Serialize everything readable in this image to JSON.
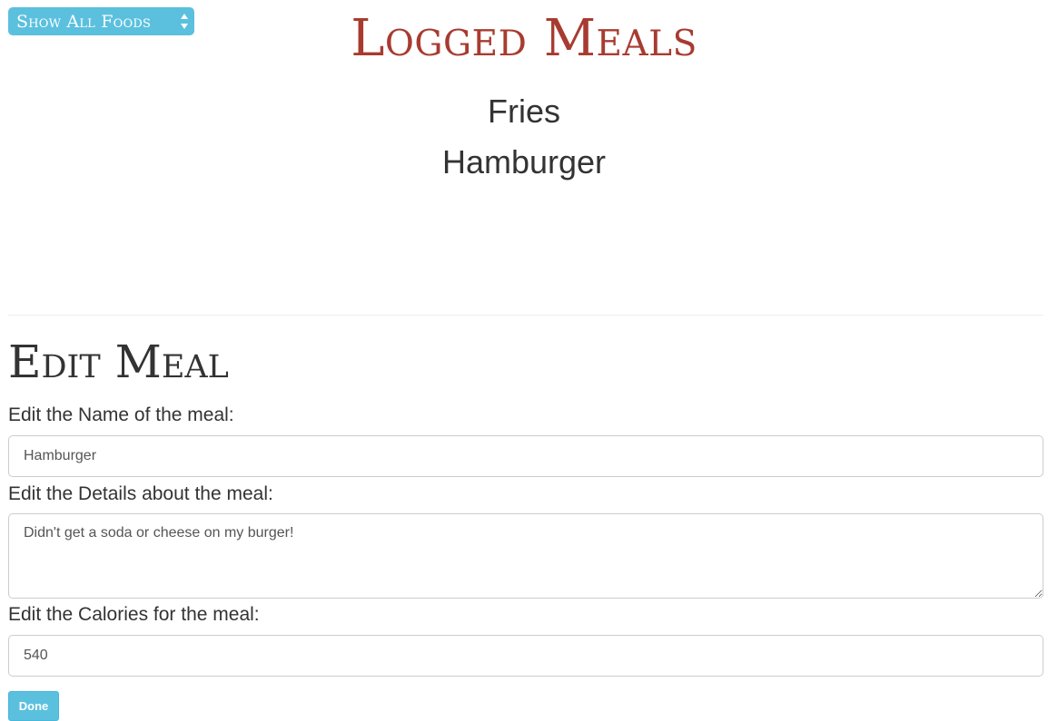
{
  "filter": {
    "selected": "Show All Foods",
    "icon": "updown-arrows-icon"
  },
  "header": {
    "title": "Logged Meals"
  },
  "meals": [
    {
      "name": "Fries"
    },
    {
      "name": "Hamburger"
    }
  ],
  "edit_form": {
    "title": "Edit Meal",
    "name_label": "Edit the Name of the meal:",
    "name_value": "Hamburger",
    "details_label": "Edit the Details about the meal:",
    "details_value": "Didn't get a soda or cheese on my burger!",
    "calories_label": "Edit the Calories for the meal:",
    "calories_value": "540",
    "done_label": "Done"
  },
  "colors": {
    "accent": "#5bc0de",
    "title": "#a83b30",
    "text": "#333333"
  }
}
